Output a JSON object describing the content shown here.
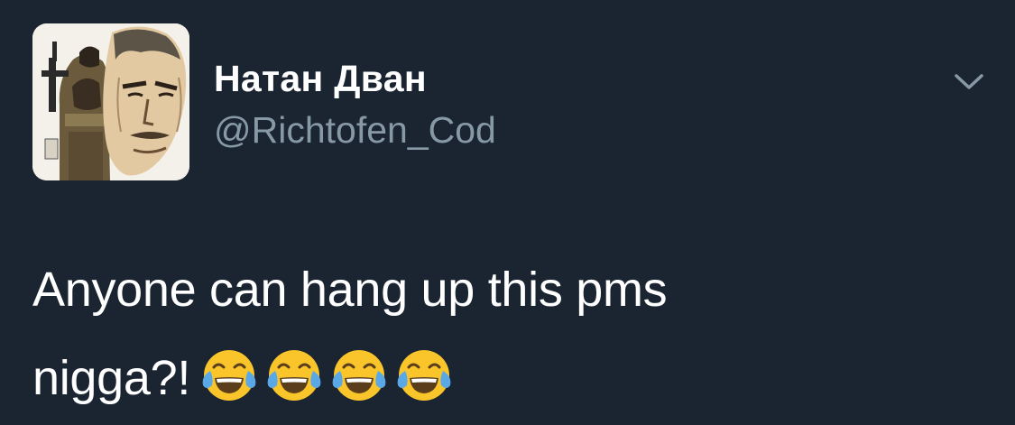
{
  "tweet": {
    "author": {
      "display_name": "Натан Дван",
      "handle": "@Richtofen_Cod",
      "avatar_icon": "comic-soldier-avatar"
    },
    "menu_icon": "chevron-down-icon",
    "text_line1": "Anyone can hang up this pms",
    "text_line2": "nigga?!",
    "emojis": [
      "face-with-tears-of-joy",
      "face-with-tears-of-joy",
      "face-with-tears-of-joy",
      "face-with-tears-of-joy"
    ]
  },
  "colors": {
    "background": "#1b2532",
    "name": "#ffffff",
    "handle": "#8899a6",
    "chevron": "#8899a6",
    "emoji_face": "#f9c52b",
    "emoji_tears": "#5aa9e6"
  }
}
